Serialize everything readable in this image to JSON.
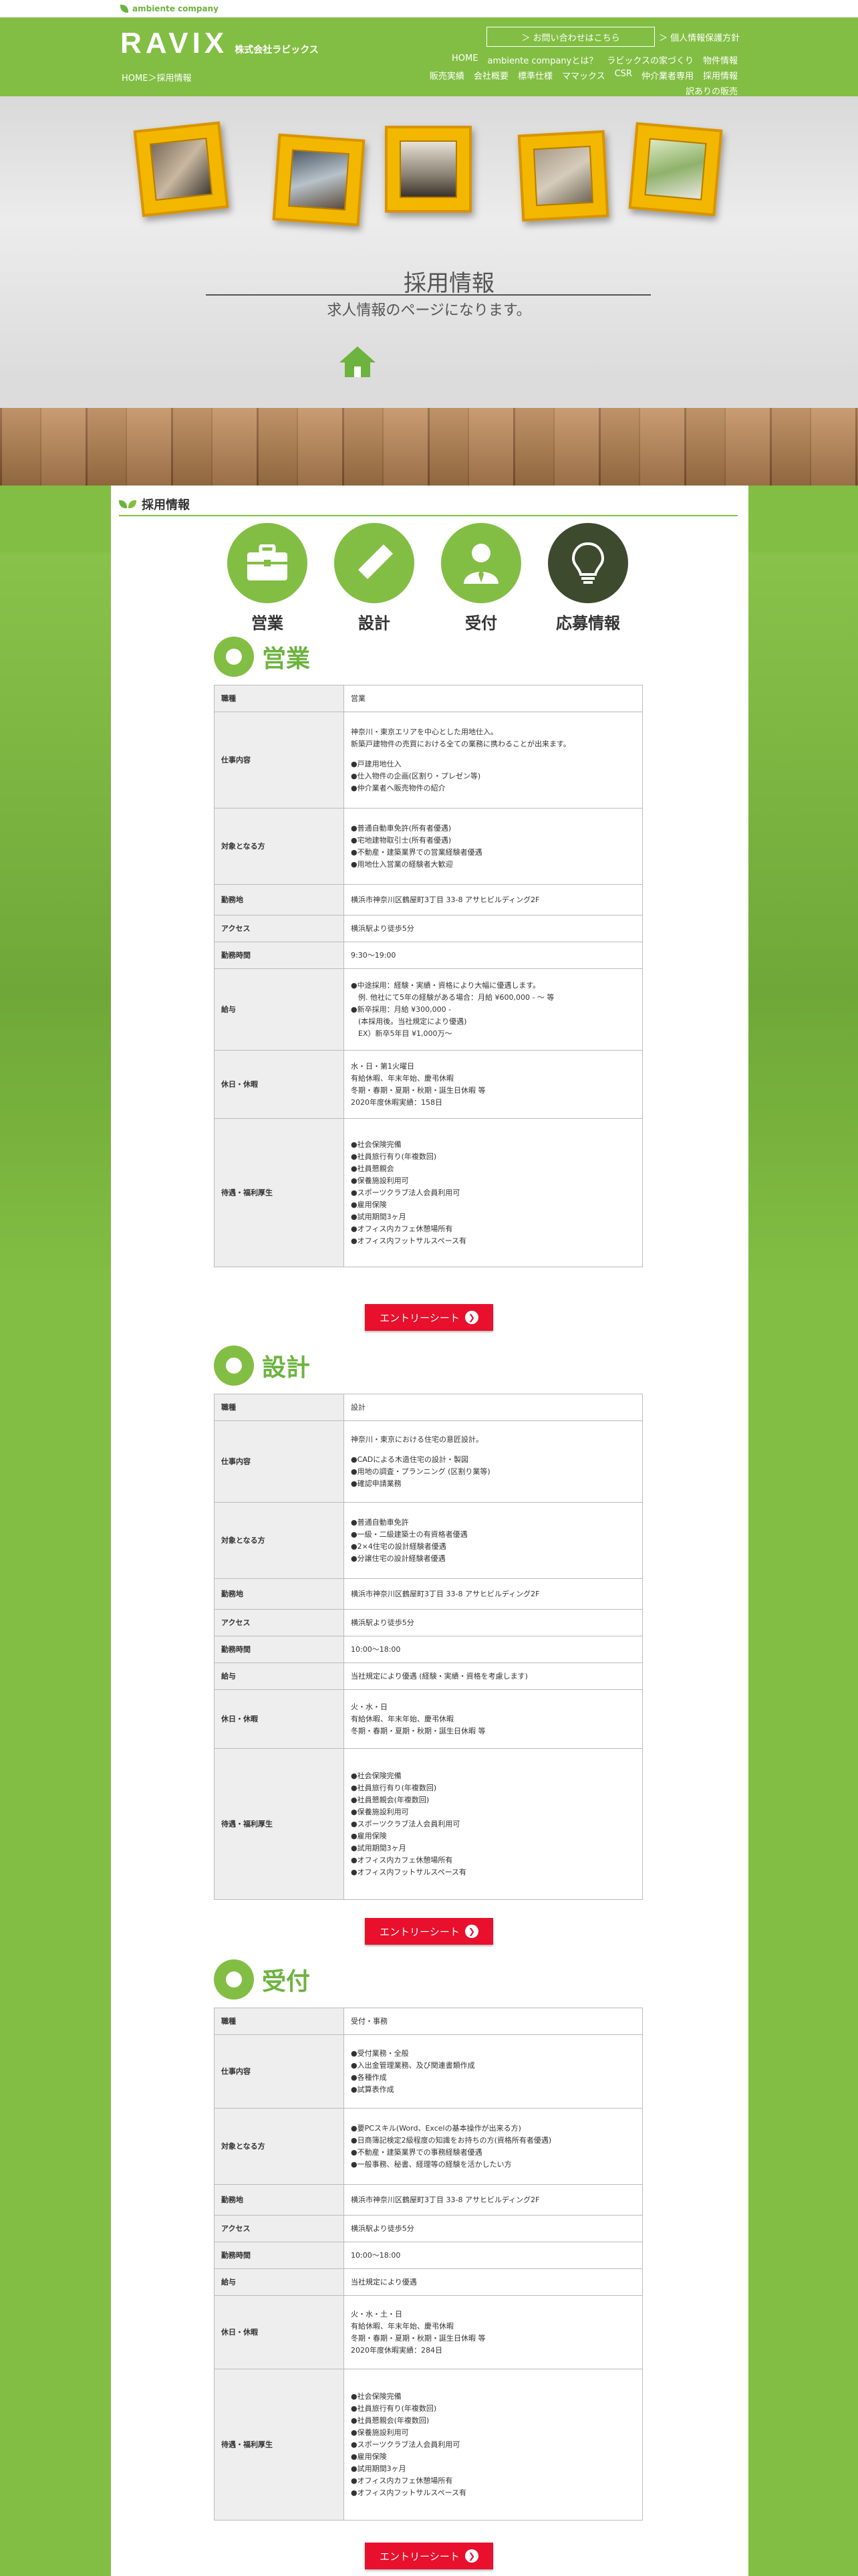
{
  "topbar": {
    "brand": "ambiente company"
  },
  "header": {
    "logo": "RAVIX",
    "company": "株式会社ラビックス",
    "breadcrumb": "HOME＞採用情報",
    "contact": "お問い合わせはこちら",
    "privacy": "個人情報保護方針",
    "nav": [
      "HOME",
      "ambiente companyとは？",
      "ラビックスの家づくり",
      "物件情報",
      "販売実績",
      "会社概要",
      "標準仕様",
      "ママックス",
      "CSR",
      "仲介業者専用",
      "採用情報",
      "訳ありの販売"
    ]
  },
  "hero": {
    "title": "採用情報",
    "subtitle": "求人情報のページになります。"
  },
  "section": {
    "title": "採用情報"
  },
  "tabs": [
    {
      "label": "営業"
    },
    {
      "label": "設計"
    },
    {
      "label": "受付"
    },
    {
      "label": "応募情報"
    }
  ],
  "entry_label": "エントリーシート",
  "jobs": [
    {
      "title": "営業",
      "rows": [
        {
          "k": "職種",
          "v": [
            "営業"
          ]
        },
        {
          "k": "仕事内容",
          "v": [
            "神奈川・東京エリアを中心とした用地仕入。",
            "新築戸建物件の売買における全ての業務に携わることが出来ます。",
            "",
            "●戸建用地仕入",
            "●仕入物件の企画(区割り・プレゼン等)",
            "●仲介業者へ販売物件の紹介"
          ]
        },
        {
          "k": "対象となる方",
          "v": [
            "●普通自動車免許(所有者優遇)",
            "●宅地建物取引士(所有者優遇)",
            "●不動産・建築業界での営業経験者優遇",
            "●用地仕入営業の経験者大歓迎"
          ]
        },
        {
          "k": "勤務地",
          "v": [
            "横浜市神奈川区鶴屋町3丁目 33-8 アサヒビルディング2F"
          ]
        },
        {
          "k": "アクセス",
          "v": [
            "横浜駅より徒歩5分"
          ]
        },
        {
          "k": "勤務時間",
          "v": [
            "9:30〜19:00"
          ]
        },
        {
          "k": "給与",
          "v": [
            "●中途採用：経験・実績・資格により大幅に優遇します。",
            "　例. 他社にて5年の経験がある場合：月給 ¥600,000 - 〜 等",
            "●新卒採用：月給 ¥300,000 -",
            "　(本採用後。当社規定により優遇)",
            "　EX）新卒5年目 ¥1,000万〜"
          ]
        },
        {
          "k": "休日・休暇",
          "v": [
            "水・日・第1火曜日",
            "有給休暇、年末年始、慶弔休暇",
            "冬期・春期・夏期・秋期・誕生日休暇 等",
            "2020年度休暇実績：158日"
          ]
        },
        {
          "k": "待遇・福利厚生",
          "v": [
            "●社会保険完備",
            "●社員旅行有り(年複数回)",
            "●社員懇親会",
            "●保養施設利用可",
            "●スポーツクラブ法人会員利用可",
            "●雇用保険",
            "●試用期間3ヶ月",
            "●オフィス内カフェ休憩場所有",
            "●オフィス内フットサルスペース有"
          ]
        }
      ]
    },
    {
      "title": "設計",
      "rows": [
        {
          "k": "職種",
          "v": [
            "設計"
          ]
        },
        {
          "k": "仕事内容",
          "v": [
            "神奈川・東京における住宅の意匠設計。",
            "",
            "●CADによる木造住宅の設計・製図",
            "●用地の調査・プランニング (区割り業等)",
            "●確認申請業務"
          ]
        },
        {
          "k": "対象となる方",
          "v": [
            "●普通自動車免許",
            "●一級・二級建築士の有資格者優遇",
            "●2×4住宅の設計経験者優遇",
            "●分譲住宅の設計経験者優遇"
          ]
        },
        {
          "k": "勤務地",
          "v": [
            "横浜市神奈川区鶴屋町3丁目 33-8 アサヒビルディング2F"
          ]
        },
        {
          "k": "アクセス",
          "v": [
            "横浜駅より徒歩5分"
          ]
        },
        {
          "k": "勤務時間",
          "v": [
            "10:00〜18:00"
          ]
        },
        {
          "k": "給与",
          "v": [
            "当社規定により優遇 (経験・実績・資格を考慮します)"
          ]
        },
        {
          "k": "休日・休暇",
          "v": [
            "火・水・日",
            "有給休暇、年末年始、慶弔休暇",
            "冬期・春期・夏期・秋期・誕生日休暇 等"
          ]
        },
        {
          "k": "待遇・福利厚生",
          "v": [
            "●社会保険完備",
            "●社員旅行有り(年複数回)",
            "●社員懇親会(年複数回)",
            "●保養施設利用可",
            "●スポーツクラブ法人会員利用可",
            "●雇用保険",
            "●試用期間3ヶ月",
            "●オフィス内カフェ休憩場所有",
            "●オフィス内フットサルスペース有"
          ]
        }
      ]
    },
    {
      "title": "受付",
      "rows": [
        {
          "k": "職種",
          "v": [
            "受付・事務"
          ]
        },
        {
          "k": "仕事内容",
          "v": [
            "●受付業務・全般",
            "●入出金管理業務、及び関連書類作成",
            "●各種作成",
            "●試算表作成"
          ]
        },
        {
          "k": "対象となる方",
          "v": [
            "●要PCスキル(Word、Excelの基本操作が出来る方)",
            "●日商簿記検定2級程度の知識をお持ちの方(資格所有者優遇)",
            "●不動産・建築業界での事務経験者優遇",
            "●一般事務、秘書、経理等の経験を活かしたい方"
          ]
        },
        {
          "k": "勤務地",
          "v": [
            "横浜市神奈川区鶴屋町3丁目 33-8 アサヒビルディング2F"
          ]
        },
        {
          "k": "アクセス",
          "v": [
            "横浜駅より徒歩5分"
          ]
        },
        {
          "k": "勤務時間",
          "v": [
            "10:00〜18:00"
          ]
        },
        {
          "k": "給与",
          "v": [
            "当社規定により優遇"
          ]
        },
        {
          "k": "休日・休暇",
          "v": [
            "火・水・土・日",
            "有給休暇、年末年始、慶弔休暇",
            "冬期・春期・夏期・秋期・誕生日休暇 等",
            "2020年度休暇実績：284日"
          ]
        },
        {
          "k": "待遇・福利厚生",
          "v": [
            "●社会保険完備",
            "●社員旅行有り(年複数回)",
            "●社員懇親会(年複数回)",
            "●保養施設利用可",
            "●スポーツクラブ法人会員利用可",
            "●雇用保険",
            "●試用期間3ヶ月",
            "●オフィス内カフェ休憩場所有",
            "●オフィス内フットサルスペース有"
          ]
        }
      ]
    }
  ]
}
